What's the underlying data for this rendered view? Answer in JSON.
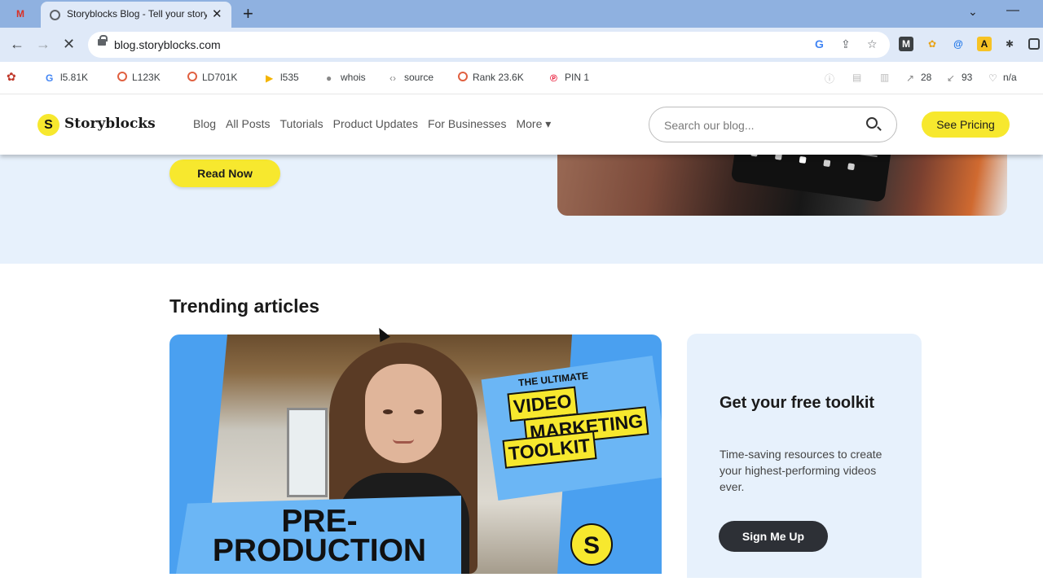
{
  "browser": {
    "tab_title": "Storyblocks Blog - Tell your story",
    "close_glyph": "✕",
    "newtab_glyph": "+",
    "url": "blog.storyblocks.com",
    "gmail_glyph": "M"
  },
  "seo_bar": {
    "items": [
      {
        "label": "l5.81K"
      },
      {
        "label": "L123K"
      },
      {
        "label": "LD701K"
      },
      {
        "label": "l535"
      },
      {
        "label": "whois"
      },
      {
        "label": "source"
      },
      {
        "label": "Rank 23.6K"
      },
      {
        "label": "PIN 1"
      }
    ],
    "right_items": [
      {
        "label": "28"
      },
      {
        "label": "93"
      },
      {
        "label": "n/a"
      }
    ]
  },
  "site": {
    "logo_text": "Storyblocks",
    "logo_mark": "S",
    "nav": [
      "Blog",
      "All Posts",
      "Tutorials",
      "Product Updates",
      "For Businesses",
      "More ▾"
    ],
    "search_placeholder": "Search our blog...",
    "cta": "See Pricing"
  },
  "hero": {
    "read_now": "Read Now"
  },
  "trending": {
    "title": "Trending articles",
    "feature": {
      "kicker": "THE ULTIMATE",
      "line1": "VIDEO",
      "line2": "MARKETING",
      "line3": "TOOLKIT",
      "pre_line1": "PRE-",
      "pre_line2": "PRODUCTION",
      "badge": "S"
    },
    "side": {
      "title": "Get your free toolkit",
      "description": "Time-saving resources to create your highest-performing videos ever.",
      "button": "Sign Me Up"
    }
  },
  "colors": {
    "brand_yellow": "#f7e82e",
    "hero_bg": "#e7f1fc",
    "dark_button": "#2d3036",
    "chrome_blue": "#8fb1e0"
  }
}
